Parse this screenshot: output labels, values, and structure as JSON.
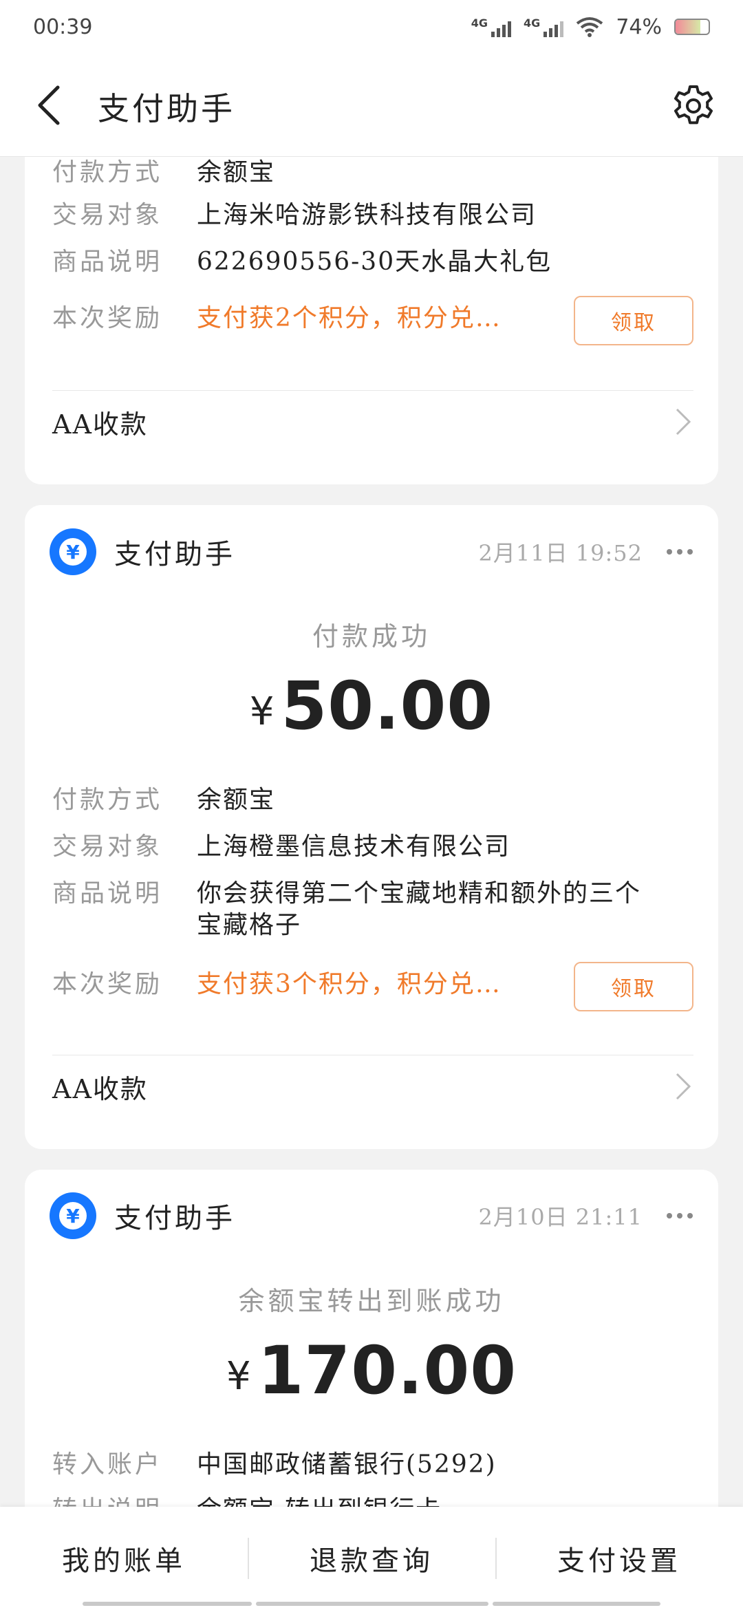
{
  "status_bar": {
    "time": "00:39",
    "net1": "4G",
    "net2": "4G",
    "battery": "74%",
    "battery_level": 0.74
  },
  "header": {
    "title": "支付助手"
  },
  "labels": {
    "pay_method": "付款方式",
    "counterparty": "交易对象",
    "item_desc": "商品说明",
    "reward": "本次奖励",
    "transfer_account": "转入账户",
    "transfer_desc": "转出说明"
  },
  "card1": {
    "pay_method": "余额宝",
    "counterparty": "上海米哈游影铁科技有限公司",
    "item_desc": "622690556-30天水晶大礼包",
    "reward": "支付获2个积分，积分兑…",
    "claim_label": "领取",
    "aa_label": "AA收款"
  },
  "card2": {
    "sender": "支付助手",
    "time": "2月11日 19:52",
    "status": "付款成功",
    "currency": "¥",
    "amount": "50.00",
    "pay_method": "余额宝",
    "counterparty": "上海橙墨信息技术有限公司",
    "item_desc_line1": "你会获得第二个宝藏地精和额外的三个",
    "item_desc_line2": "宝藏格子",
    "reward": "支付获3个积分，积分兑…",
    "claim_label": "领取",
    "aa_label": "AA收款"
  },
  "card3": {
    "sender": "支付助手",
    "time": "2月10日 21:11",
    "status": "余额宝转出到账成功",
    "currency": "¥",
    "amount": "170.00",
    "transfer_account": "中国邮政储蓄银行(5292)",
    "transfer_desc": "余额宝-转出到银行卡"
  },
  "bottom_tabs": [
    "我的账单",
    "退款查询",
    "支付设置"
  ]
}
